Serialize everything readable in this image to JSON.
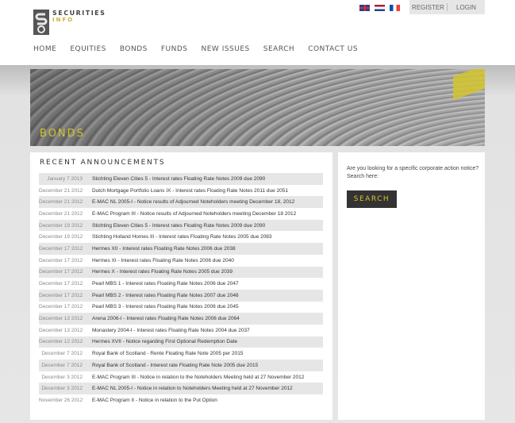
{
  "header": {
    "logo_line1": "SECURITIES",
    "logo_line2": "INFO",
    "register": "REGISTER",
    "login": "LOGIN"
  },
  "nav": [
    "HOME",
    "EQUITIES",
    "BONDS",
    "FUNDS",
    "NEW ISSUES",
    "SEARCH",
    "CONTACT US"
  ],
  "hero": {
    "title": "BONDS"
  },
  "recent": {
    "title": "RECENT ANNOUNCEMENTS",
    "items": [
      {
        "date": "January 7 2013",
        "title": "Stichting Eleven Cities 5 - Interest rates Floating Rate Notes 2009 due 2090"
      },
      {
        "date": "December 21 2012",
        "title": "Dutch Mortgage Portfolio Loans IX - Interest rates Floating Rate Notes 2011 due 2051"
      },
      {
        "date": "December 21 2012",
        "title": "E-MAC NL 2005-I - Notice results of Adjourned Noteholders meeting December 18, 2012"
      },
      {
        "date": "December 21 2012",
        "title": "E-MAC Program III - Notice results of Adjourned Noteholders meeting December 18 2012"
      },
      {
        "date": "December 19 2012",
        "title": "Stichting Eleven Cities 5 - Interest rates Floating Rate Notes 2009 due 2090"
      },
      {
        "date": "December 19 2012",
        "title": "Stichting Holland Homes III - Interest rates Floating Rate Notes 2005 due 2083"
      },
      {
        "date": "December 17 2012",
        "title": "Hermes XII - Interest rates Floating Rate Notes 2006 due 2038"
      },
      {
        "date": "December 17 2012",
        "title": "Hermes XI - Interest rates Floating Rate Notes 2006 due 2040"
      },
      {
        "date": "December 17 2012",
        "title": "Hermes X - Interest rates Floating Rate Notes 2005 due 2039"
      },
      {
        "date": "December 17 2012",
        "title": "Pearl MBS 1 - Interest rates Floating Rate Notes 2006 due 2047"
      },
      {
        "date": "December 17 2012",
        "title": "Pearl MBS 2 - Interest rates Floating Rate Notes 2007 due 2046"
      },
      {
        "date": "December 17 2012",
        "title": "Pearl MBS 3 - Interest rates Floating Rate Notes 2008 due 2045"
      },
      {
        "date": "December 13 2012",
        "title": "Arena 2006-I - Interest rates Floating Rate Notes 2006 due 2064"
      },
      {
        "date": "December 13 2012",
        "title": "Monastery 2004-I - Interest rates Floating Rate Notes 2004 due 2037"
      },
      {
        "date": "December 12 2012",
        "title": "Hermes XVII - Notice regarding First Optional Redemption Date"
      },
      {
        "date": "December 7 2012",
        "title": "Royal Bank of Scotland - Rente Floating Rate Note 2005 per 2015"
      },
      {
        "date": "December 7 2012",
        "title": "Royal Bank of Scotland - Interest rate Floating Rate Note 2005 due 2015"
      },
      {
        "date": "December 3 2012",
        "title": "E-MAC Program III - Notice in relation to the Noteholders Meeting held at 27 November 2012"
      },
      {
        "date": "December 3 2012",
        "title": "E-MAC NL 2005-I - Notice in relation to Noteholders Meeting held at 27 November 2012"
      },
      {
        "date": "November 26 2012",
        "title": "E-MAC Program II - Notice in relation to the Put Option"
      }
    ]
  },
  "sidebar": {
    "prompt": "Are you looking for a specific corporate action notice? Search here:",
    "button": "SEARCH"
  }
}
